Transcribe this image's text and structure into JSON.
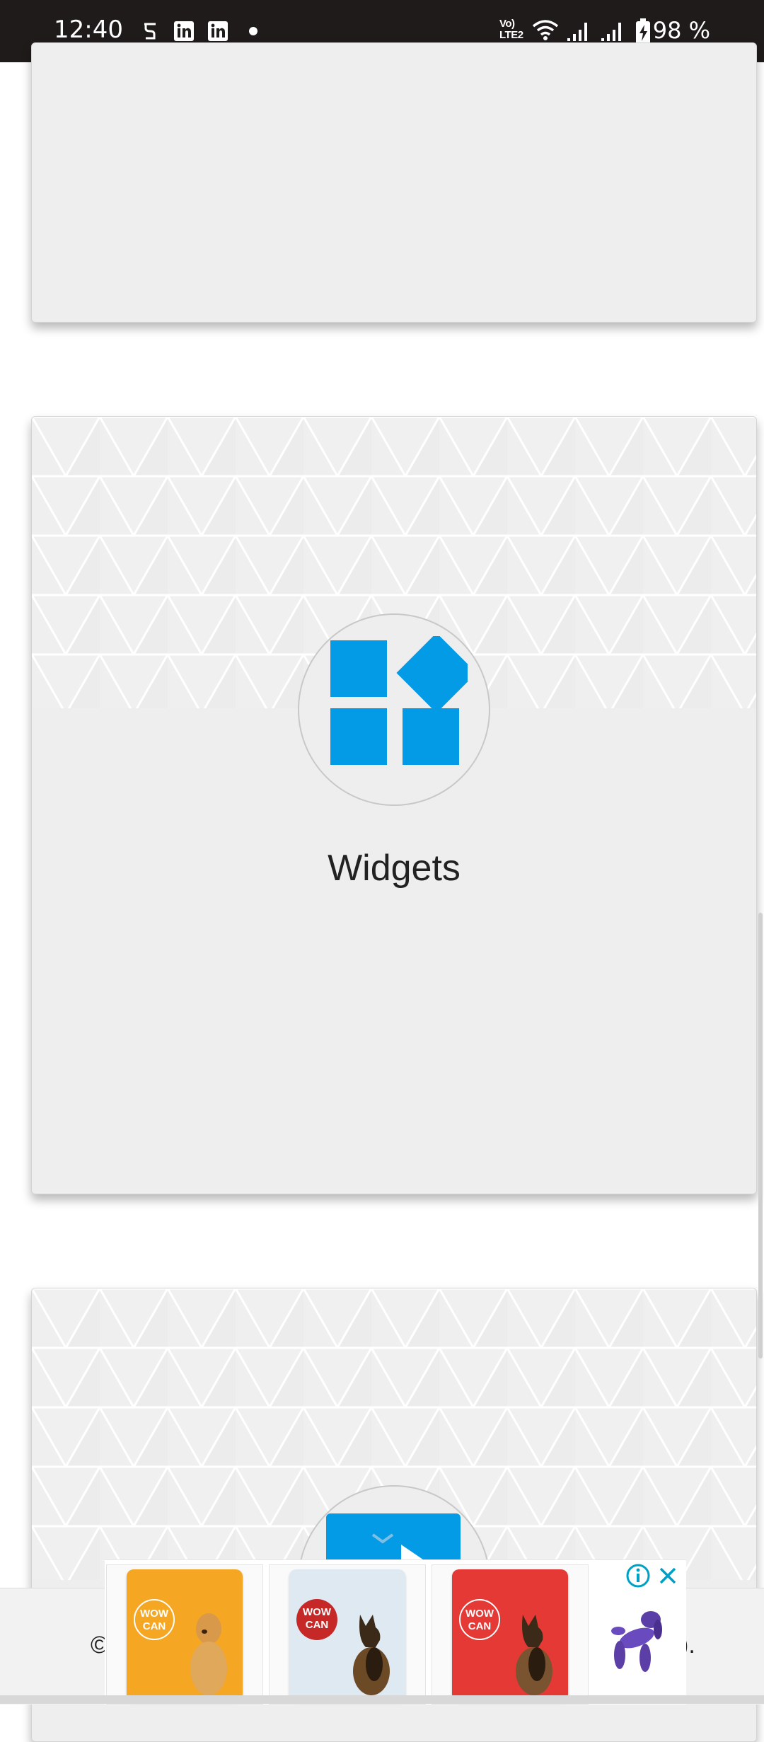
{
  "status_bar": {
    "time": "12:40",
    "battery": "98 %",
    "network_label": "Vo) LTE2",
    "icons": [
      "notification-icon",
      "linkedin-icon",
      "linkedin-icon",
      "dot-icon",
      "volte-icon",
      "wifi-icon",
      "signal-icon",
      "signal-icon",
      "battery-charging-icon"
    ]
  },
  "cards": [
    {
      "label": ""
    },
    {
      "label": "Widgets",
      "icon": "widgets-icon",
      "icon_color": "#039be5"
    },
    {
      "label": "",
      "icon": "app-icon",
      "icon_color": "#039be5"
    }
  ],
  "footer": {
    "left_text": "©",
    "right_text": ")."
  },
  "ad": {
    "products": [
      {
        "brand": "WOW CAN",
        "color": "#f5a623"
      },
      {
        "brand": "WOW CAN",
        "color": "#d0e4f2"
      },
      {
        "brand": "WOW CAN",
        "color": "#e53935"
      }
    ],
    "info_icon": "info-icon",
    "close_icon": "close-icon",
    "logo_icon": "balloon-dog-icon",
    "accent_color": "#00a0c6"
  }
}
